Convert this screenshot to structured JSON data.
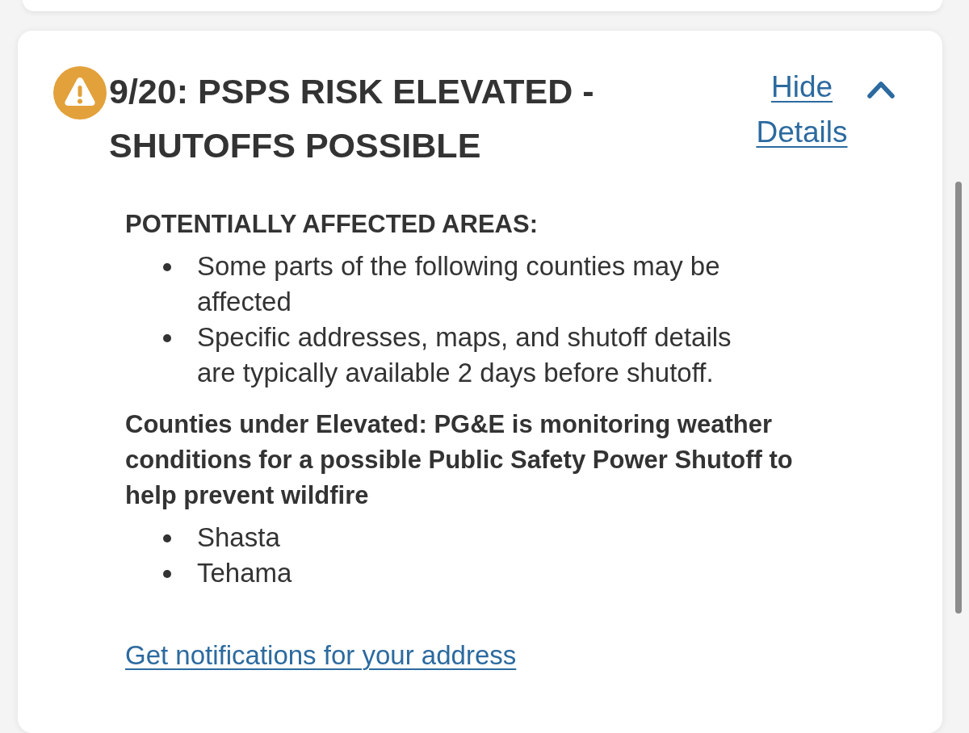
{
  "alert": {
    "title": "9/20: PSPS RISK ELEVATED - SHUTOFFS POSSIBLE",
    "toggle": {
      "label": "Hide Details",
      "expanded": true
    },
    "sections": [
      {
        "heading": "POTENTIALLY AFFECTED AREAS:",
        "items": [
          "Some parts of the following counties may be affected",
          "Specific addresses, maps, and shutoff details are typically available 2 days before shutoff."
        ]
      },
      {
        "heading": "Counties under Elevated: PG&E is monitoring weather conditions for a possible Public Safety Power Shutoff to help prevent wildfire",
        "items": [
          "Shasta",
          "Tehama"
        ]
      }
    ],
    "link": "Get notifications for your address"
  }
}
